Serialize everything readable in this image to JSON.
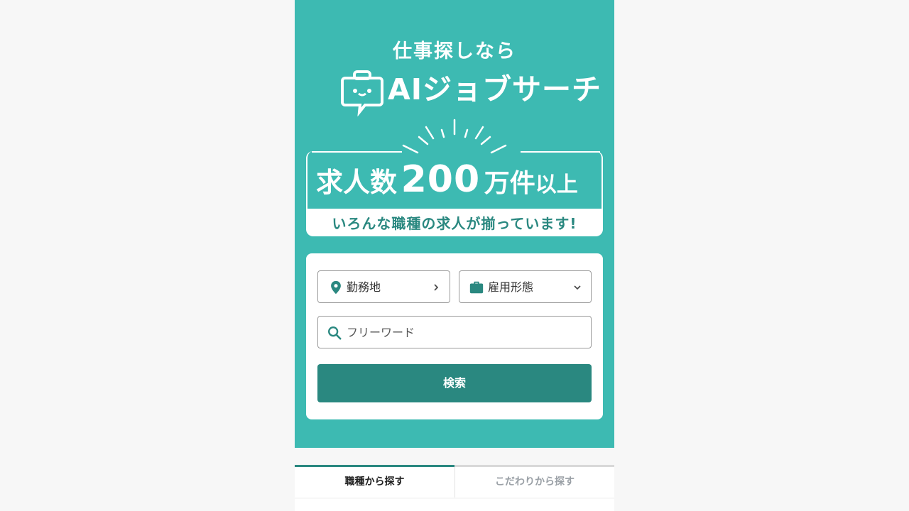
{
  "hero": {
    "tagline": "仕事探しなら",
    "logo_text": "AIジョブサーチ",
    "banner": {
      "prefix": "求人数",
      "number": "200",
      "unit": "万件",
      "suffix": "以上",
      "subtitle": "いろんな職種の求人が揃っています!"
    },
    "colors": {
      "background": "#3dbab2",
      "accent": "#2a8880"
    }
  },
  "search": {
    "location_label": "勤務地",
    "employment_label": "雇用形態",
    "keyword_placeholder": "フリーワード",
    "submit_label": "検索",
    "icons": {
      "location": "map-pin-icon",
      "employment": "briefcase-icon",
      "keyword": "search-icon"
    }
  },
  "tabs": [
    {
      "label": "職種から探す",
      "active": true
    },
    {
      "label": "こだわりから探す",
      "active": false
    }
  ]
}
